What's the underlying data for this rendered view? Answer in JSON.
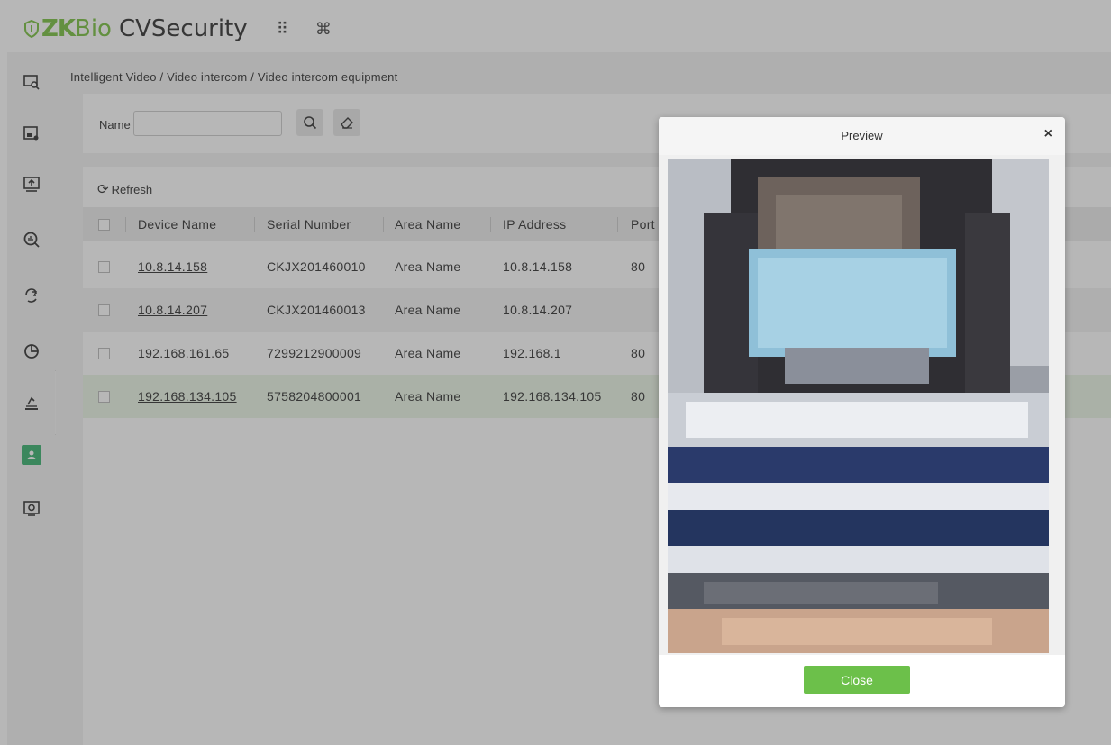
{
  "app": {
    "logo_zk": "ZK",
    "logo_bio": "Bio",
    "logo_name": "CVSecurity",
    "apps_icon_glyph": "⠿",
    "command_icon_glyph": "⌘"
  },
  "sidebar": {
    "items": [
      {
        "icon": "video-search-icon"
      },
      {
        "icon": "device-camera-icon"
      },
      {
        "icon": "screen-upload-icon"
      },
      {
        "icon": "search-analytics-icon"
      },
      {
        "icon": "hand-gesture-icon"
      },
      {
        "icon": "pie-chart-icon"
      },
      {
        "icon": "scanner-icon"
      },
      {
        "icon": "video-intercom-icon",
        "active": true
      },
      {
        "icon": "camera-settings-icon"
      }
    ],
    "collapse_glyph": "»"
  },
  "breadcrumb": "Intelligent Video / Video intercom / Video intercom equipment",
  "search": {
    "label": "Name",
    "value": "",
    "placeholder": ""
  },
  "toolbar": {
    "refresh_label": "Refresh"
  },
  "table": {
    "columns": [
      "Device Name",
      "Serial Number",
      "Area Name",
      "IP Address",
      "Port"
    ],
    "rows": [
      {
        "device_name": "10.8.14.158",
        "serial_number": "CKJX201460010",
        "area_name": "Area Name",
        "ip_address": "10.8.14.158",
        "port": "80"
      },
      {
        "device_name": "10.8.14.207",
        "serial_number": "CKJX201460013",
        "area_name": "Area Name",
        "ip_address": "10.8.14.207",
        "port": ""
      },
      {
        "device_name": "192.168.161.65",
        "serial_number": "7299212900009",
        "area_name": "Area Name",
        "ip_address": "192.168.1",
        "port": "80"
      },
      {
        "device_name": "192.168.134.105",
        "serial_number": "5758204800001",
        "area_name": "Area Name",
        "ip_address": "192.168.134.105",
        "port": "80"
      }
    ]
  },
  "dialog": {
    "title": "Preview",
    "close_glyph": "×",
    "close_button_label": "Close"
  },
  "colors": {
    "brand_green": "#7ac143",
    "button_green": "#6cc04a",
    "active_icon_green": "#3cb371"
  }
}
